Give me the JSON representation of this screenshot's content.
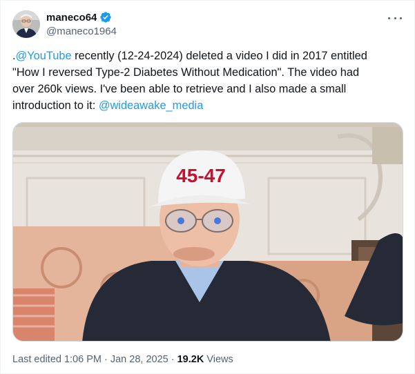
{
  "author": {
    "display_name": "maneco64",
    "handle": "@maneco1964",
    "avatar_icon": "avatar-photo",
    "verified_icon": "verified-badge-icon",
    "verified_color": "#1d9bf0"
  },
  "tweet": {
    "line1_prefix": ".",
    "line1_mention": "@YouTube",
    "line1_rest": " recently (12-24-2024) deleted a video I did in 2017 entitled",
    "line2": "\"How I reversed Type-2 Diabetes Without Medication\". The video had",
    "line3": "over 260k views. I've been able to retrieve and I also made a small",
    "line4_prefix": "introduction to it: ",
    "line4_mention": "@wideawake_media",
    "link_color": "#1d9bf0"
  },
  "media": {
    "cap_text": "45-47",
    "cap_text_color": "#c8102e"
  },
  "footer": {
    "edited_time": "Last edited 1:06 PM · Jan 28, 2025",
    "separator": " · ",
    "views_count": "19.2K",
    "views_label": " Views"
  },
  "more_icon": "more-options-icon"
}
